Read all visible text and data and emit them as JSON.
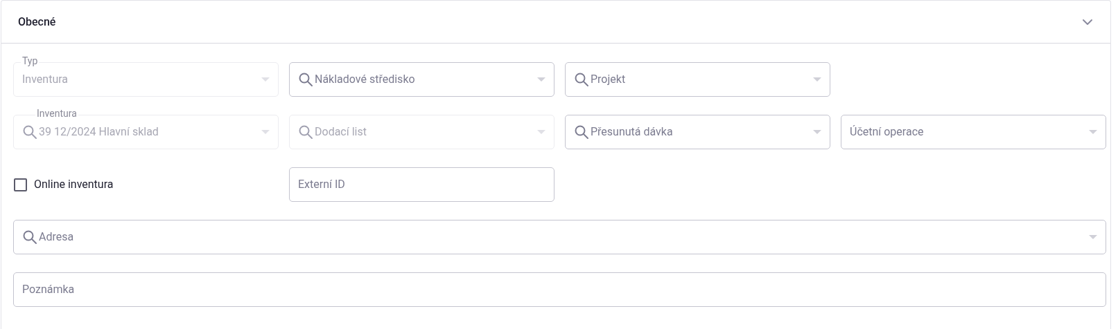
{
  "section": {
    "title": "Obecné",
    "expanded": true
  },
  "rows": [
    [
      {
        "kind": "select",
        "search": false,
        "disabled": true,
        "label": "Typ",
        "value": "Inventura"
      },
      {
        "kind": "select",
        "search": true,
        "disabled": false,
        "placeholder": "Nákladové středisko"
      },
      {
        "kind": "select",
        "search": true,
        "disabled": false,
        "placeholder": "Projekt"
      }
    ],
    [
      {
        "kind": "select",
        "search": true,
        "disabled": true,
        "label": "Inventura",
        "value": "39 12/2024 Hlavní sklad"
      },
      {
        "kind": "select",
        "search": true,
        "disabled": true,
        "placeholder": "Dodací list"
      },
      {
        "kind": "select",
        "search": true,
        "disabled": false,
        "placeholder": "Přesunutá dávka"
      },
      {
        "kind": "select",
        "search": false,
        "disabled": false,
        "placeholder": "Účetní operace"
      }
    ],
    [
      {
        "kind": "checkbox",
        "label": "Online inventura",
        "checked": false
      },
      {
        "kind": "text",
        "disabled": false,
        "placeholder": "Externí ID"
      }
    ],
    [
      {
        "kind": "select",
        "search": true,
        "disabled": false,
        "placeholder": "Adresa"
      }
    ],
    [
      {
        "kind": "text",
        "disabled": false,
        "placeholder": "Poznámka"
      }
    ]
  ]
}
